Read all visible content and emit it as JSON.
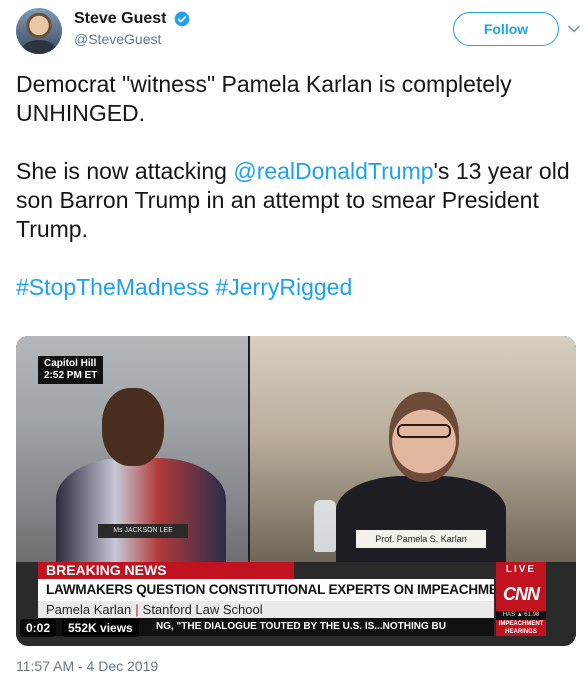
{
  "author": {
    "display_name": "Steve Guest",
    "handle": "@SteveGuest",
    "verified": true
  },
  "actions": {
    "follow_label": "Follow"
  },
  "tweet": {
    "line1": "Democrat \"witness\" Pamela Karlan is completely UNHINGED.",
    "line2_before": "She is now attacking ",
    "line2_mention": "@realDonaldTrump",
    "line2_after": "'s 13 year old son Barron Trump in an attempt to smear President Trump.",
    "hashtag1": "#StopTheMadness",
    "hashtag2": "#JerryRigged"
  },
  "video": {
    "location_line1": "Capitol Hill",
    "location_line2": "2:52 PM ET",
    "nameplate_left": "Ms JACKSON LEE",
    "nameplate_right": "Prof. Pamela S. Karlan",
    "breaking_label": "BREAKING NEWS",
    "live_label": "LIVE",
    "headline": "LAWMAKERS QUESTION CONSTITUTIONAL EXPERTS ON IMPEACHMENT",
    "guest_name": "Pamela Karlan",
    "guest_affiliation": "Stanford Law School",
    "ticker": "NG, \"THE DIALOGUE TOUTED BY THE U.S. IS...NOTHING BU",
    "network_logo": "CNN",
    "market_text": "HAS ▲ 61.98",
    "impeachment_label": "IMPEACHMENT HEARINGS",
    "elapsed": "0:02",
    "views": "552K views"
  },
  "meta": {
    "timestamp": "11:57 AM - 4 Dec 2019"
  },
  "colors": {
    "accent": "#1da1f2",
    "cnn_red": "#c1121f",
    "muted_text": "#657786"
  }
}
